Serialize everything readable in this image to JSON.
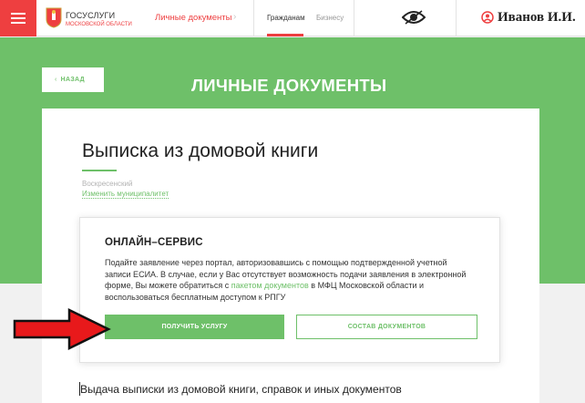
{
  "header": {
    "brand_title": "ГОСУСЛУГИ",
    "brand_sub": "МОСКОВСКОЙ ОБЛАСТИ",
    "section_link": "Личные документы",
    "nav": [
      {
        "label": "Гражданам",
        "active": true
      },
      {
        "label": "Бизнесу",
        "active": false
      }
    ],
    "user_name": "Иванов И.И."
  },
  "banner": {
    "back_label": "НАЗАД",
    "page_title": "ЛИЧНЫЕ ДОКУМЕНТЫ"
  },
  "card": {
    "doc_title": "Выписка из домовой книги",
    "municipality": "Воскресенский",
    "change_municipality": "Изменить муниципалитет"
  },
  "service": {
    "title": "ОНЛАЙН–СЕРВИС",
    "text_before_link": "Подайте заявление через портал, авторизовавшись с помощью подтвержденной учетной записи ЕСИА. В случае, если у Вас отсутствует возможность подачи заявления в электронной форме, Вы можете обратиться с",
    "link_text": "пакетом документов",
    "text_after_link": "в МФЦ Московской области и воспользоваться бесплатным доступом к РПГУ",
    "get_service_label": "ПОЛУЧИТЬ УСЛУГУ",
    "docs_label": "СОСТАВ ДОКУМЕНТОВ"
  },
  "bottom": {
    "heading": "Выдача выписки из домовой книги, справок и иных документов"
  },
  "colors": {
    "accent_red": "#ee3f40",
    "accent_green": "#6ec069"
  },
  "icons": [
    "menu-icon",
    "coat-of-arms-icon",
    "chevron-right-icon",
    "eye-icon",
    "user-icon",
    "chevron-left-icon",
    "red-arrow-icon"
  ]
}
